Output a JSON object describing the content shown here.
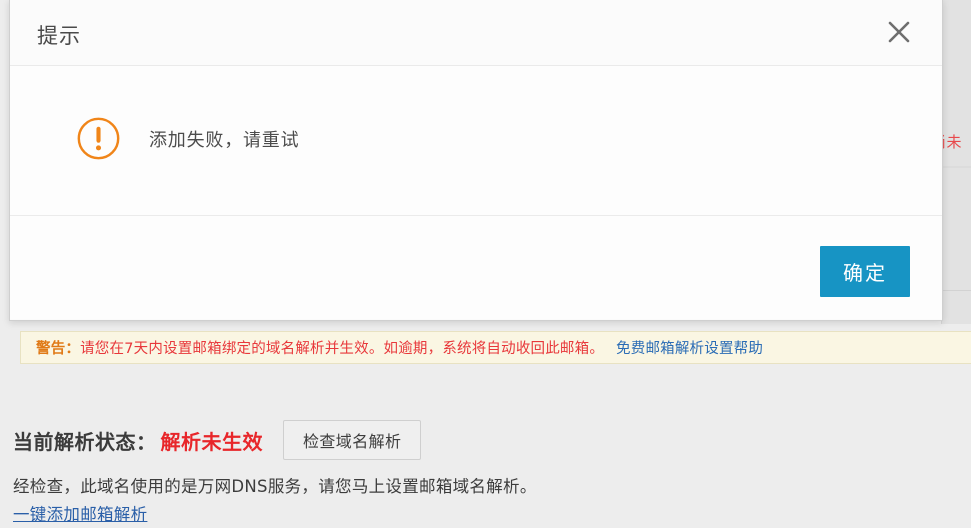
{
  "dialog": {
    "title": "提示",
    "close_icon": "close-icon",
    "warning_icon": "exclamation-circle-icon",
    "message": "添加失败，请重试",
    "confirm_label": "确定",
    "accent_color": "#1794c4",
    "icon_color": "#f08519"
  },
  "background": {
    "right_partial_text": "尚未"
  },
  "warning_bar": {
    "label": "警告：",
    "text": "请您在7天内设置邮箱绑定的域名解析并生效。如逾期，系统将自动收回此邮箱。",
    "link": "免费邮箱解析设置帮助",
    "label_color": "#e07a17",
    "text_color": "#e8383b",
    "link_color": "#2a6cb5",
    "background_color": "#faf6e3"
  },
  "status": {
    "label": "当前解析状态：",
    "value": "解析未生效",
    "value_color": "#e8262a",
    "check_button": "检查域名解析"
  },
  "description": {
    "text": "经检查，此域名使用的是万网DNS服务，请您马上设置邮箱域名解析。",
    "link": "一键添加邮箱解析",
    "link_color": "#2a5fa8"
  }
}
